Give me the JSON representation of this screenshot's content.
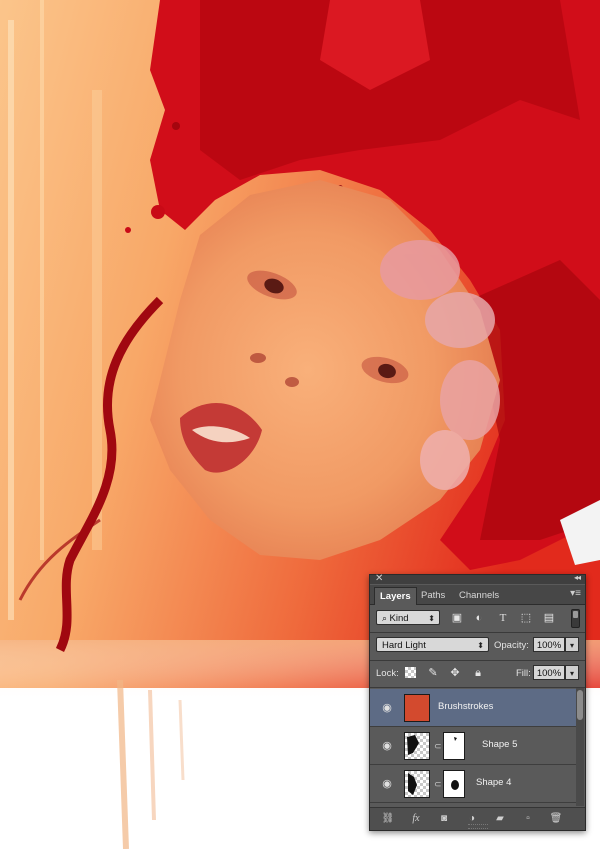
{
  "panel": {
    "close_glyph": "✕",
    "collapse_glyph": "◂◂",
    "tabs": [
      {
        "label": "Layers"
      },
      {
        "label": "Paths"
      },
      {
        "label": "Channels"
      }
    ],
    "active_tab": "Layers",
    "filter": {
      "kind_label": "Kind",
      "kind_caret": "⬍",
      "icons": [
        "image-filter-icon",
        "adjustment-filter-icon",
        "type-filter-icon",
        "shape-filter-icon",
        "smart-object-filter-icon"
      ]
    },
    "blend": {
      "mode": "Hard Light",
      "opacity_label": "Opacity:",
      "opacity": "100%"
    },
    "lock": {
      "label": "Lock:",
      "icons": [
        "lock-transparent-icon",
        "lock-paint-icon",
        "lock-position-icon",
        "lock-all-icon"
      ],
      "fill_label": "Fill:",
      "fill": "100%"
    },
    "layers": [
      {
        "name": "Brushstrokes",
        "selected": true,
        "visible": true,
        "thumb": "red-texture"
      },
      {
        "name": "Shape 5",
        "selected": false,
        "visible": true,
        "thumb": "shape-with-mask"
      },
      {
        "name": "Shape 4",
        "selected": false,
        "visible": true,
        "thumb": "shape-with-mask"
      }
    ],
    "footer_icons": [
      "link-layers-icon",
      "fx-icon",
      "add-mask-icon",
      "adjustment-layer-icon",
      "new-group-icon",
      "new-layer-icon",
      "trash-icon"
    ],
    "fx_label": "fx"
  },
  "colors": {
    "panel_bg": "#5a5a5a",
    "selected_row": "#5d6b85",
    "art_red": "#d40b16",
    "art_orange": "#f7a25e"
  }
}
